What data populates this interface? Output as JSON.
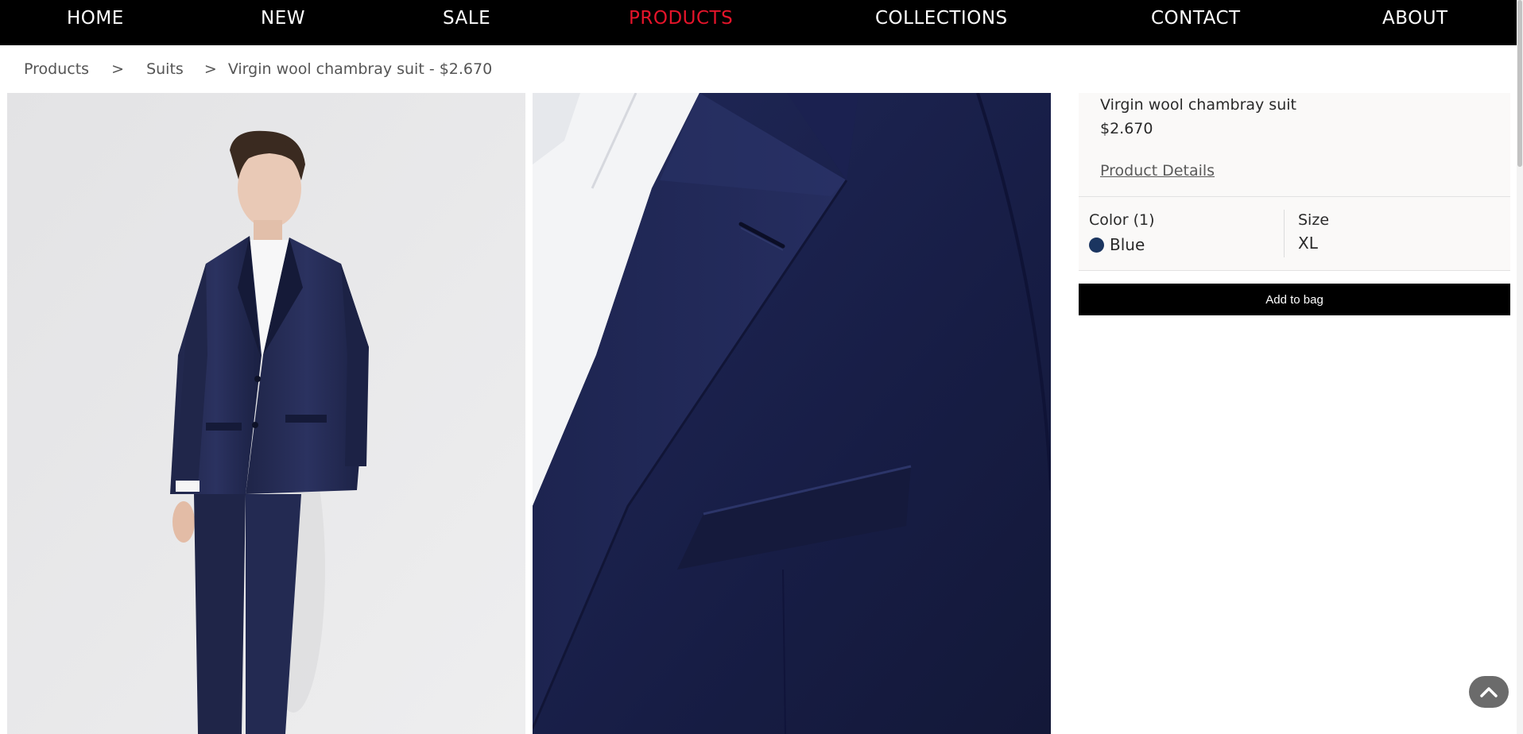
{
  "nav": {
    "items": [
      {
        "label": "HOME"
      },
      {
        "label": "NEW"
      },
      {
        "label": "SALE"
      },
      {
        "label": "PRODUCTS"
      },
      {
        "label": "COLLECTIONS"
      },
      {
        "label": "CONTACT"
      },
      {
        "label": "ABOUT"
      }
    ],
    "active": "PRODUCTS",
    "active_color": "#e5142a",
    "background": "#000000"
  },
  "breadcrumb": {
    "items": [
      "Products",
      "Suits",
      "Virgin wool chambray suit - $2.670"
    ],
    "separator": ">"
  },
  "product": {
    "name": "Virgin wool chambray suit",
    "price": "$2.670",
    "details_link": "Product Details",
    "color_label": "Color (1)",
    "color_value": "Blue",
    "color_swatch": "#1b3560",
    "size_label": "Size",
    "size_value": "XL",
    "add_to_bag": "Add to bag"
  },
  "images": [
    {
      "subject": "model wearing navy suit, full view"
    },
    {
      "subject": "navy suit lapel and chest pocket close-up"
    }
  ],
  "icons": {
    "scroll_top": "chevron-up-icon"
  }
}
